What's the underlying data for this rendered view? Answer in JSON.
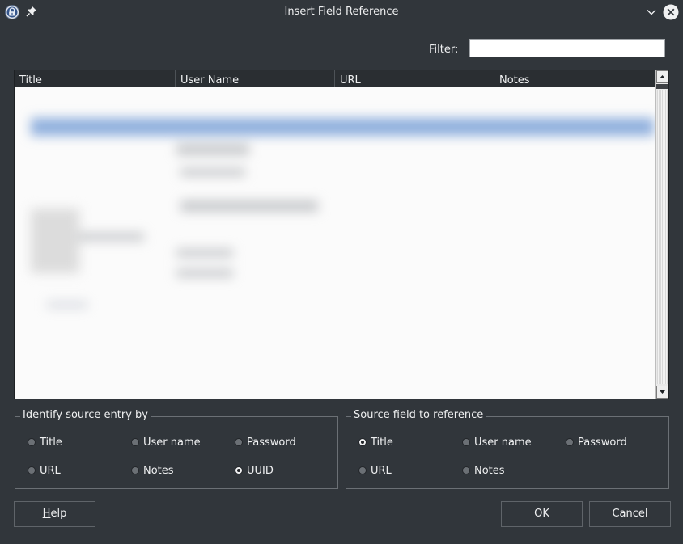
{
  "window": {
    "title": "Insert Field Reference"
  },
  "filter": {
    "label": "Filter:",
    "value": ""
  },
  "table": {
    "columns": [
      "Title",
      "User Name",
      "URL",
      "Notes"
    ],
    "rows_obscured": true
  },
  "identify_group": {
    "title": "Identify source entry by",
    "options": [
      "Title",
      "User name",
      "Password",
      "URL",
      "Notes",
      "UUID"
    ],
    "selected": "UUID"
  },
  "source_group": {
    "title": "Source field to reference",
    "options": [
      "Title",
      "User name",
      "Password",
      "URL",
      "Notes"
    ],
    "selected": "Title"
  },
  "buttons": {
    "help": "Help",
    "ok": "OK",
    "cancel": "Cancel"
  },
  "icons": {
    "app": "keepass-lock-icon",
    "pin": "pin-icon",
    "minimize": "chevron-down-icon",
    "close": "close-icon"
  }
}
